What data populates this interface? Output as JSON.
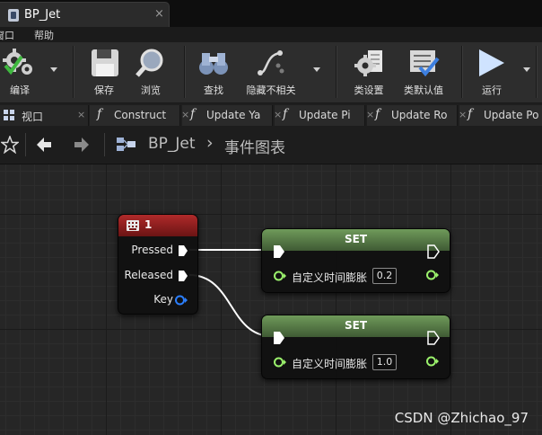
{
  "window": {
    "tab_title": "BP_Jet",
    "tab_close": "×"
  },
  "menu": {
    "items": [
      "窗口",
      "帮助"
    ],
    "first_visible": "窗口",
    "second": "帮助"
  },
  "toolbar": {
    "compile": "编译",
    "save": "保存",
    "browse": "浏览",
    "find": "查找",
    "hide_unrelated": "隐藏不相关",
    "class_settings": "类设置",
    "class_defaults": "类默认值",
    "run": "运行"
  },
  "tabs": {
    "viewport": "视口",
    "construct": "Construct",
    "update1": "Update Ya",
    "update2": "Update Pi",
    "update3": "Update Ro",
    "update4": "Update Po"
  },
  "breadcrumb": {
    "blueprint": "BP_Jet",
    "separator": "›",
    "graph": "事件图表"
  },
  "graph": {
    "key_node": {
      "title": "1",
      "pins": {
        "pressed": "Pressed",
        "released": "Released",
        "key": "Key"
      }
    },
    "set_node_1": {
      "title": "SET",
      "var_label": "自定义时间膨胀",
      "value": "0.2"
    },
    "set_node_2": {
      "title": "SET",
      "var_label": "自定义时间膨胀",
      "value": "1.0"
    }
  },
  "watermark": "CSDN @Zhichao_97",
  "colors": {
    "key_header": "#8a1c1c",
    "set_header": "#5a7a4a",
    "float_pin": "#9bf26c",
    "key_pin": "#2b7fff",
    "exec_wire": "#ffffff"
  }
}
